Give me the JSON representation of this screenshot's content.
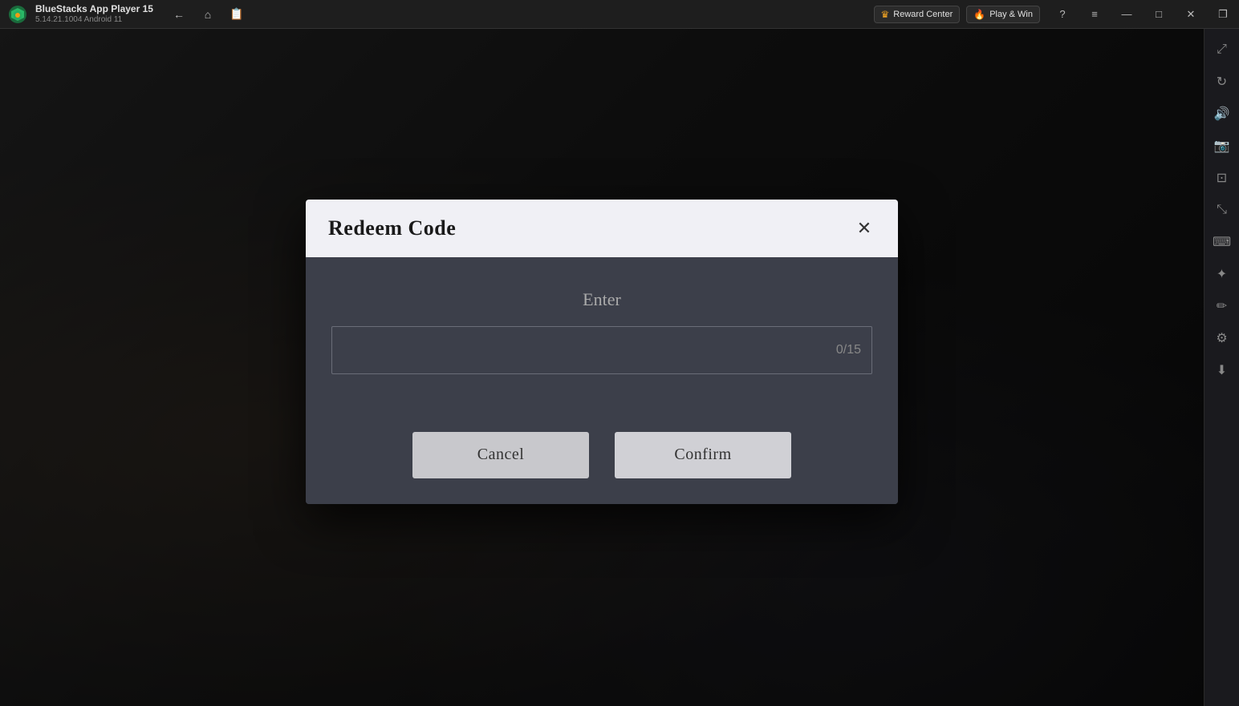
{
  "titlebar": {
    "app_name": "BlueStacks App Player 15",
    "version": "5.14.21.1004  Android 11",
    "reward_center_label": "Reward Center",
    "play_win_label": "Play & Win",
    "nav": {
      "back_title": "Back",
      "home_title": "Home",
      "copy_title": "Copy"
    },
    "controls": {
      "help": "?",
      "menu": "≡",
      "minimize": "—",
      "maximize": "□",
      "close": "✕",
      "restore": "❐"
    }
  },
  "sidebar": {
    "icons": [
      {
        "name": "expand-icon",
        "symbol": "⤢"
      },
      {
        "name": "rotate-icon",
        "symbol": "↻"
      },
      {
        "name": "volume-icon",
        "symbol": "🔊"
      },
      {
        "name": "camera-icon",
        "symbol": "📷"
      },
      {
        "name": "screenshot-icon",
        "symbol": "⊡"
      },
      {
        "name": "resize-icon",
        "symbol": "⤡"
      },
      {
        "name": "keyboard-icon",
        "symbol": "⌨"
      },
      {
        "name": "joystick-icon",
        "symbol": "🕹"
      },
      {
        "name": "brush-icon",
        "symbol": "✏"
      },
      {
        "name": "settings-icon",
        "symbol": "⚙"
      },
      {
        "name": "download-icon",
        "symbol": "⬇"
      }
    ]
  },
  "modal": {
    "title": "Redeem Code",
    "close_label": "✕",
    "enter_label": "Enter",
    "input_placeholder": "",
    "char_counter": "0/15",
    "cancel_label": "Cancel",
    "confirm_label": "Confirm"
  }
}
